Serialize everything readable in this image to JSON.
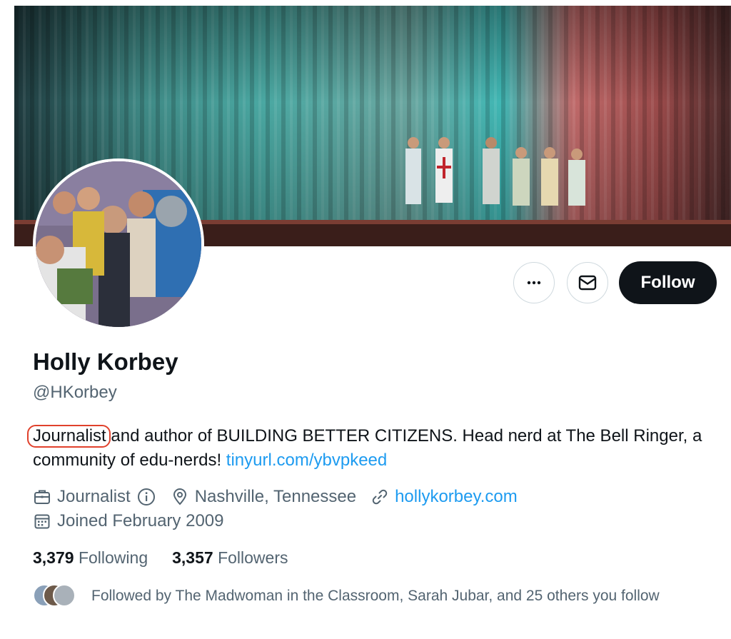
{
  "profile": {
    "name": "Holly Korbey",
    "handle": "@HKorbey",
    "bio_highlight": "Journalist",
    "bio_text": " and author of BUILDING BETTER CITIZENS. Head nerd at The Bell Ringer, a community of edu-nerds! ",
    "bio_link": "tinyurl.com/ybvpkeed",
    "profession": "Journalist",
    "location": "Nashville, Tennessee",
    "website": "hollykorbey.com",
    "joined": "Joined February 2009"
  },
  "stats": {
    "following_count": "3,379",
    "following_label": "Following",
    "followers_count": "3,357",
    "followers_label": "Followers"
  },
  "actions": {
    "follow_label": "Follow"
  },
  "followed_by": {
    "text": "Followed by The Madwoman in the Classroom, Sarah Jubar, and 25 others you follow"
  },
  "colors": {
    "accent": "#1d9bf0",
    "text_primary": "#0f1419",
    "text_secondary": "#536471",
    "highlight_ring": "#e0412c"
  },
  "icons": [
    "more-icon",
    "mail-icon",
    "briefcase-icon",
    "info-icon",
    "location-pin-icon",
    "link-icon",
    "calendar-icon"
  ]
}
